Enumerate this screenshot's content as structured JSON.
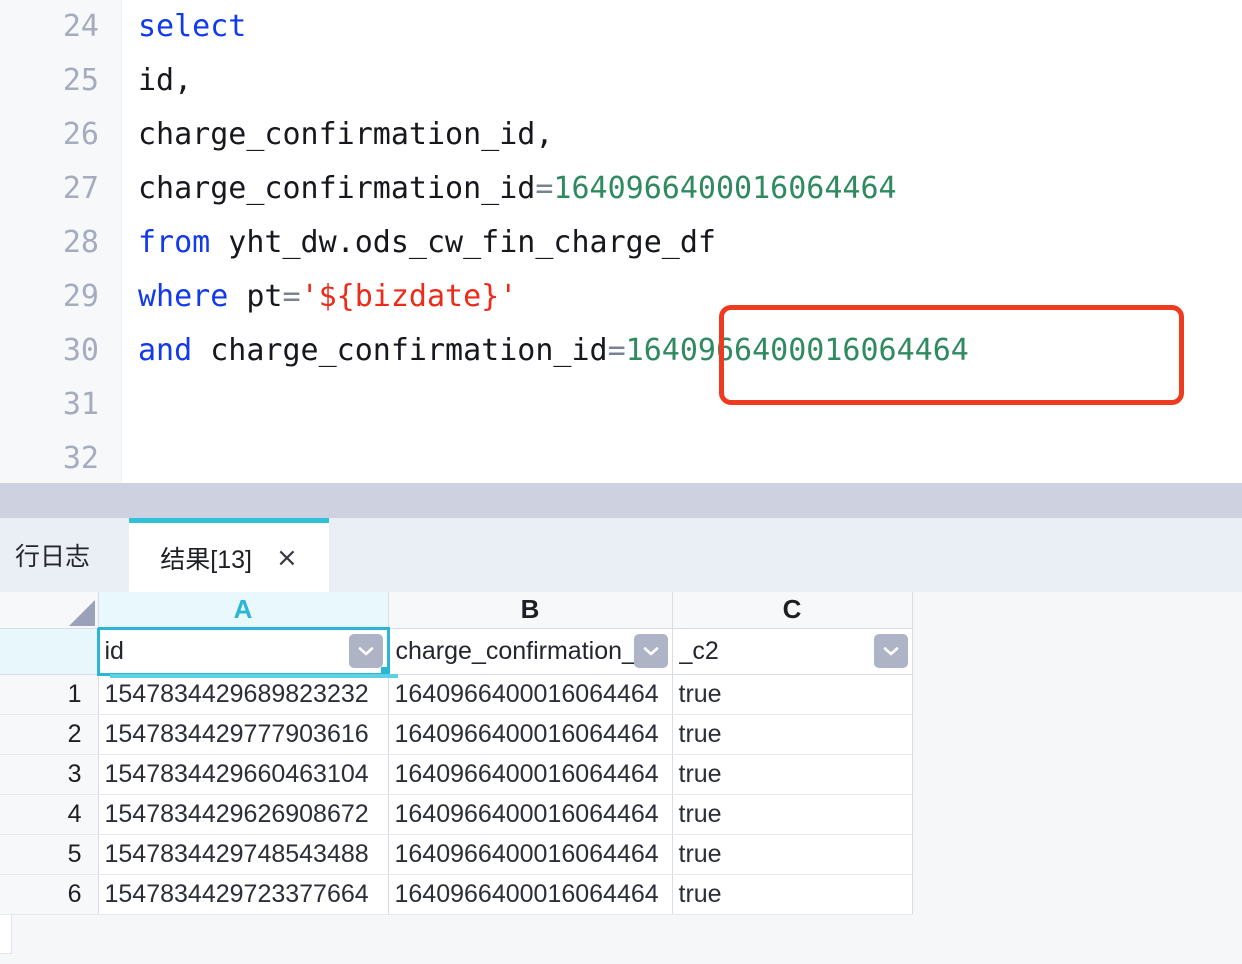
{
  "editor": {
    "line_numbers": [
      "24",
      "25",
      "26",
      "27",
      "28",
      "29",
      "30",
      "31",
      "32"
    ],
    "lines": [
      {
        "n": "24",
        "tokens": [
          {
            "t": "select",
            "c": "kw"
          }
        ]
      },
      {
        "n": "25",
        "tokens": [
          {
            "t": "id,",
            "c": "plain"
          }
        ]
      },
      {
        "n": "26",
        "tokens": [
          {
            "t": "charge_confirmation_id,",
            "c": "plain"
          }
        ]
      },
      {
        "n": "27",
        "tokens": [
          {
            "t": "charge_confirmation_id",
            "c": "plain"
          },
          {
            "t": "=",
            "c": "op"
          },
          {
            "t": "1640966400016064464",
            "c": "num"
          }
        ]
      },
      {
        "n": "28",
        "tokens": [
          {
            "t": "from",
            "c": "kw"
          },
          {
            "t": " yht_dw.ods_cw_fin_charge_df",
            "c": "plain"
          }
        ]
      },
      {
        "n": "29",
        "tokens": [
          {
            "t": "where",
            "c": "kw"
          },
          {
            "t": " pt",
            "c": "plain"
          },
          {
            "t": "=",
            "c": "op"
          },
          {
            "t": "'${bizdate}'",
            "c": "str"
          }
        ]
      },
      {
        "n": "30",
        "tokens": [
          {
            "t": "and",
            "c": "kw"
          },
          {
            "t": " charge_confirmation_id",
            "c": "plain"
          },
          {
            "t": "=",
            "c": "op"
          },
          {
            "t": "1640966400016064464",
            "c": "num"
          }
        ]
      },
      {
        "n": "31",
        "tokens": []
      },
      {
        "n": "32",
        "tokens": []
      }
    ],
    "annotation": {
      "highlighted_value": "1640966400016064464",
      "border_color": "#ee3b1f"
    },
    "colors": {
      "keyword": "#1139ee",
      "number": "#2f8a60",
      "string": "#ec2b1a",
      "operator": "#7a8292",
      "plain": "#16181d",
      "gutter_text": "#a5acbf"
    }
  },
  "results_panel": {
    "tabs": [
      {
        "label": "行日志",
        "active": false,
        "closable": false
      },
      {
        "label": "结果[13]",
        "active": true,
        "closable": true,
        "close_label": "×"
      }
    ],
    "active_tab_accent": "#2ec1d8",
    "grid": {
      "column_letters": [
        "A",
        "B",
        "C"
      ],
      "selected_column_letter": "A",
      "field_names": [
        "id",
        "charge_confirmation_id",
        "_c2"
      ],
      "field_names_displayed": [
        "id",
        "charge_confirmation_i",
        "_c2"
      ],
      "selected_field_cell": "id",
      "row_numbers": [
        "1",
        "2",
        "3",
        "4",
        "5",
        "6"
      ],
      "rows": [
        [
          "1547834429689823232",
          "1640966400016064464",
          "true"
        ],
        [
          "1547834429777903616",
          "1640966400016064464",
          "true"
        ],
        [
          "1547834429660463104",
          "1640966400016064464",
          "true"
        ],
        [
          "1547834429626908672",
          "1640966400016064464",
          "true"
        ],
        [
          "1547834429748543488",
          "1640966400016064464",
          "true"
        ],
        [
          "1547834429723377664",
          "1640966400016064464",
          "true"
        ]
      ],
      "selection_color": "#2ab6d4",
      "dropdown_icon": "chevron-down-icon"
    }
  }
}
